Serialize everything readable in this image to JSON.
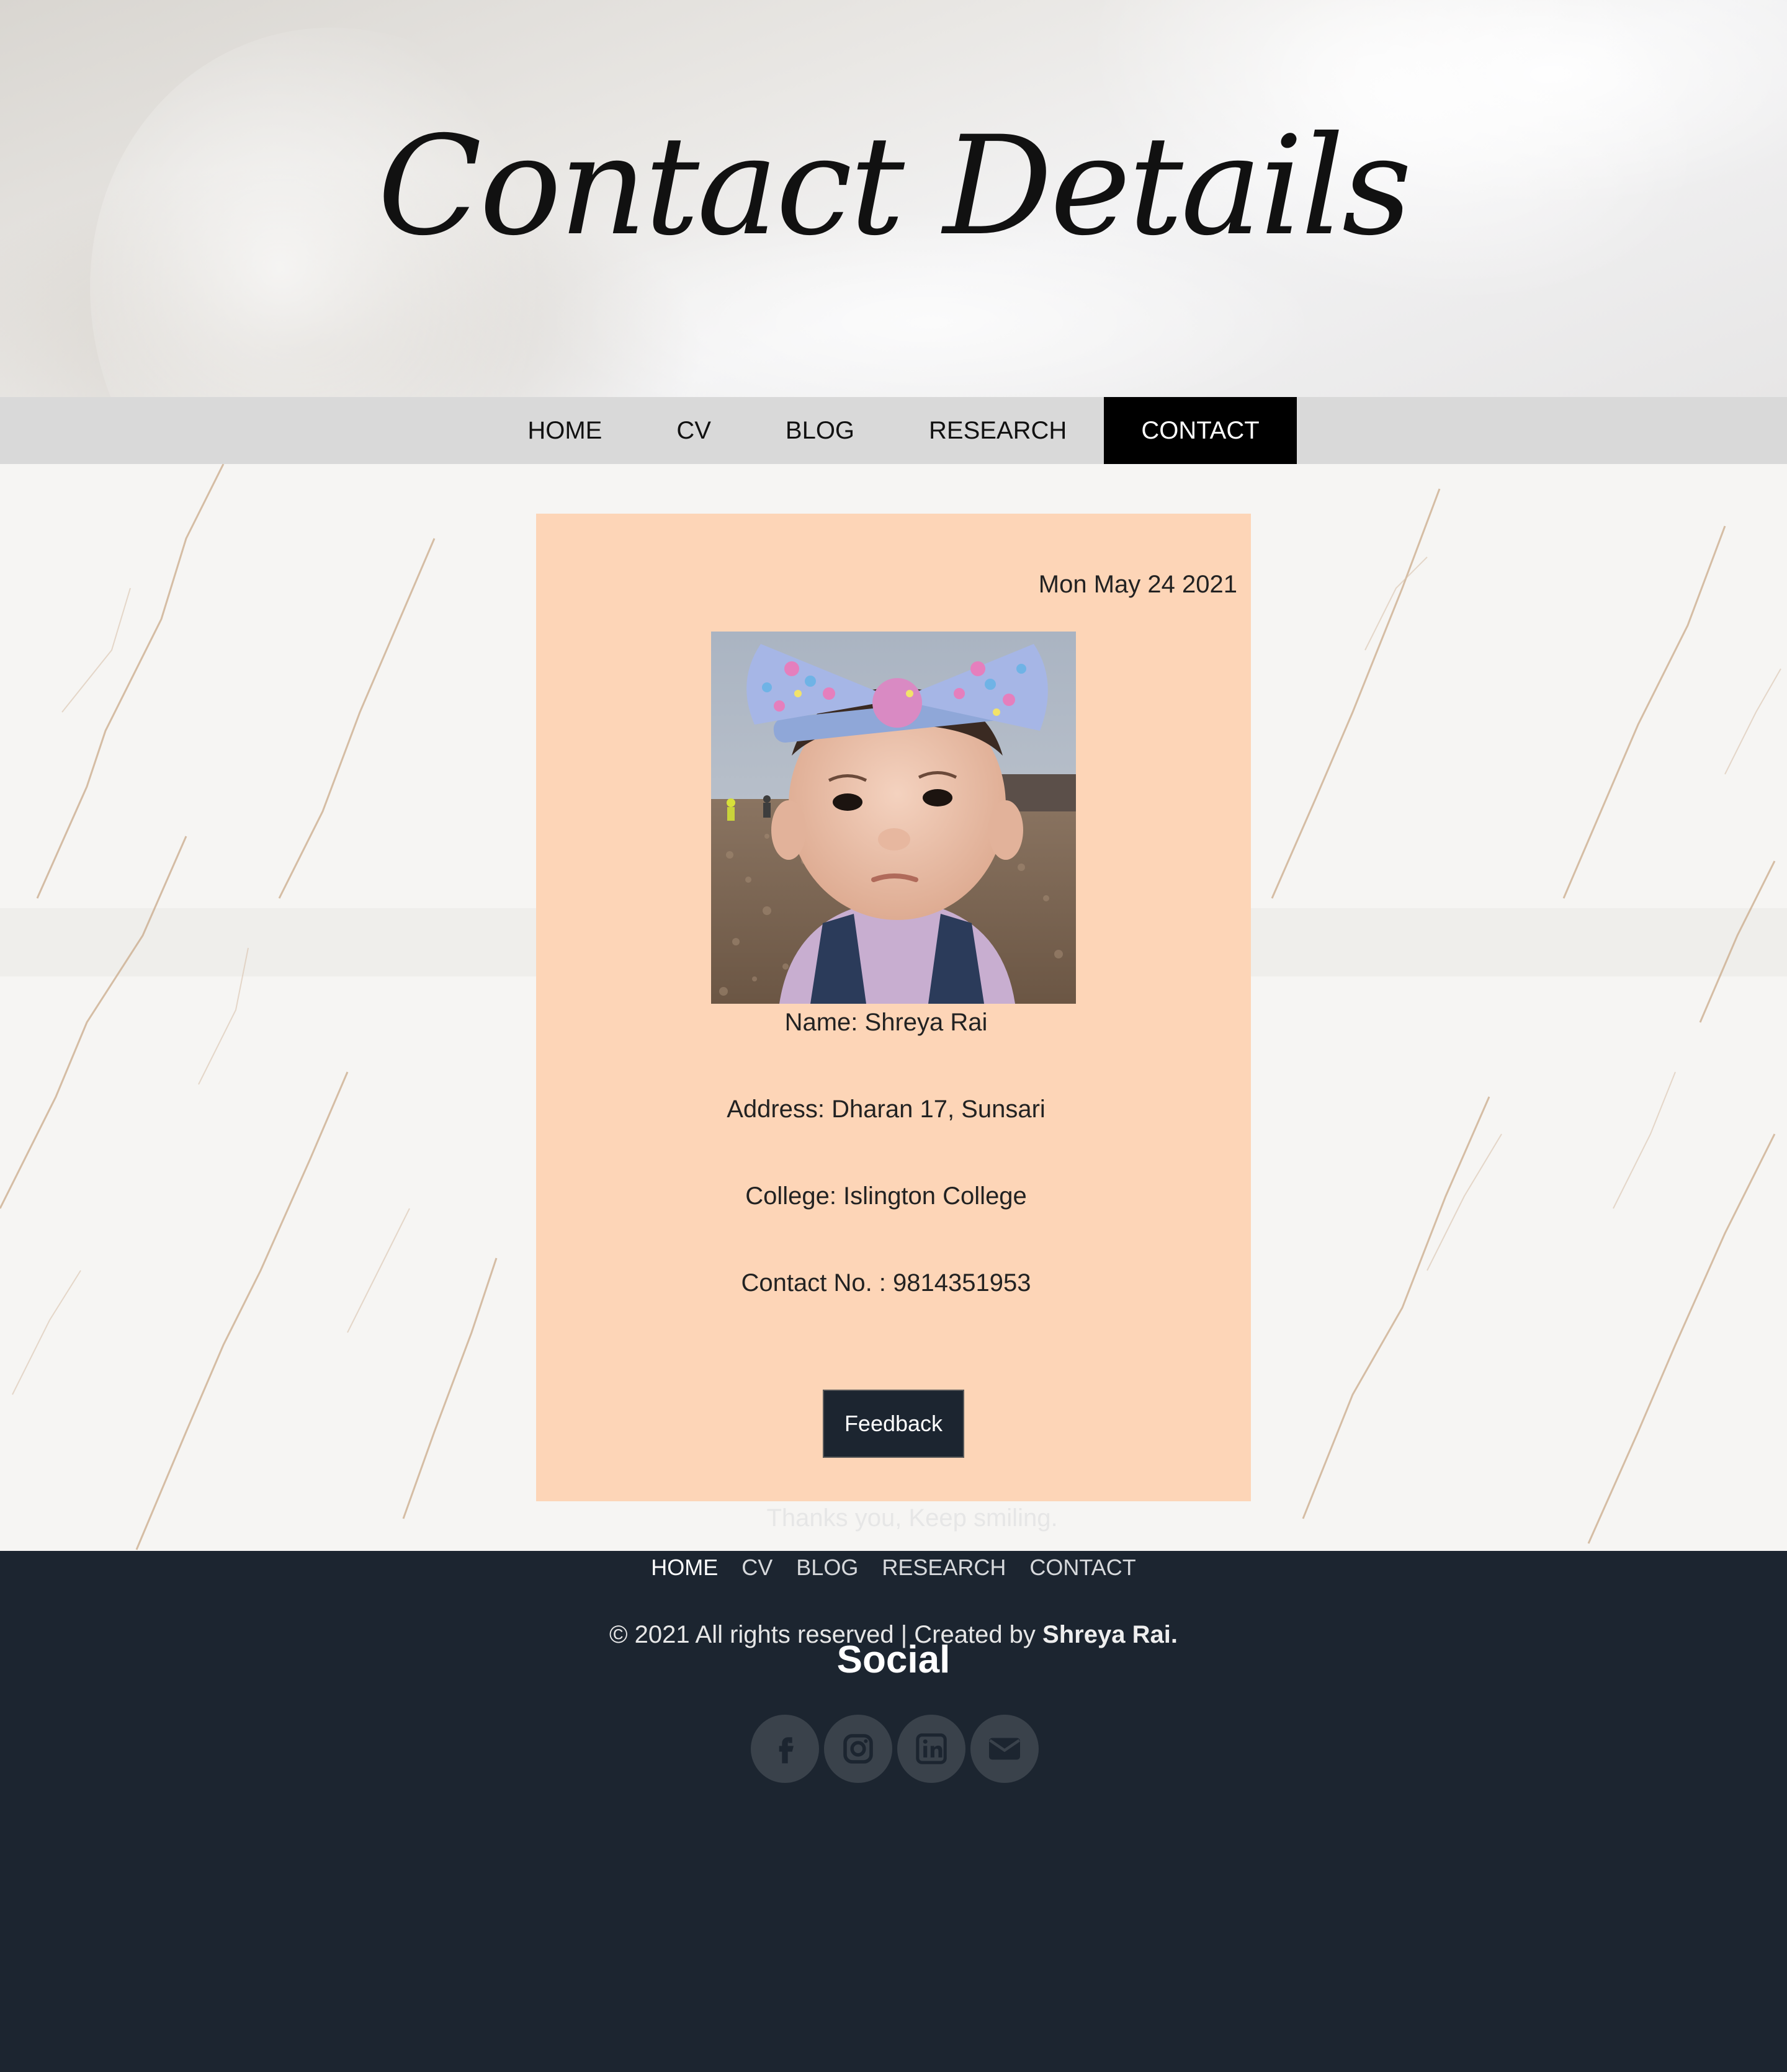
{
  "hero": {
    "title": "Contact Details"
  },
  "nav": {
    "items": [
      {
        "label": "HOME"
      },
      {
        "label": "CV"
      },
      {
        "label": "BLOG"
      },
      {
        "label": "RESEARCH"
      },
      {
        "label": "CONTACT",
        "active": true
      }
    ]
  },
  "card": {
    "date": "Mon May 24 2021",
    "photo": "profile-photo",
    "name": "Name: Shreya Rai",
    "address": "Address: Dharan 17, Sunsari",
    "college": "College: Islington College",
    "contact": "Contact No. : 9814351953",
    "feedback_label": "Feedback",
    "background_color": "#fdd5b7"
  },
  "footer": {
    "nav": [
      {
        "label": "HOME",
        "active": true
      },
      {
        "label": "CV"
      },
      {
        "label": "BLOG"
      },
      {
        "label": "RESEARCH"
      },
      {
        "label": "CONTACT"
      }
    ],
    "social_title": "Social",
    "social_icons": [
      "facebook-icon",
      "instagram-icon",
      "linkedin-icon",
      "envelope-icon"
    ],
    "thanks": "Thanks you, Keep smiling.",
    "copyright_prefix": "© 2021 All rights reserved | Created by ",
    "copyright_name": "Shreya Rai.",
    "background_color": "#1c2530"
  }
}
